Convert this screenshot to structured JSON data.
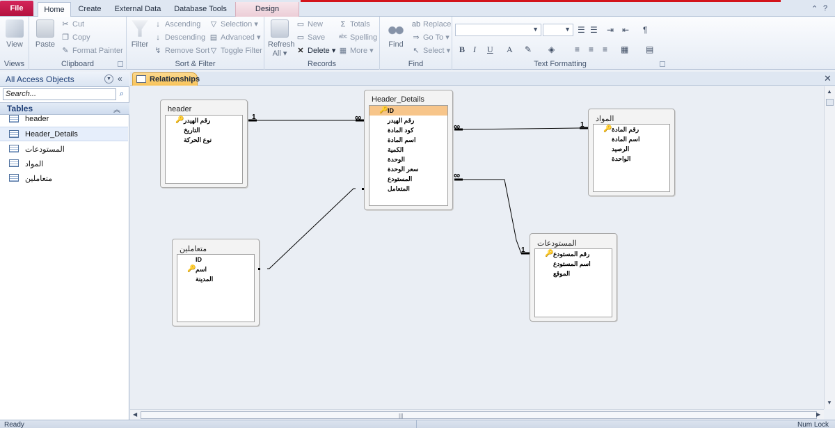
{
  "ribbon_tabs": {
    "file": "File",
    "home": "Home",
    "create": "Create",
    "external_data": "External Data",
    "database_tools": "Database Tools",
    "design": "Design"
  },
  "groups": {
    "views": {
      "label": "Views",
      "view": "View"
    },
    "clipboard": {
      "label": "Clipboard",
      "paste": "Paste",
      "cut": "Cut",
      "copy": "Copy",
      "format_painter": "Format Painter"
    },
    "sort_filter": {
      "label": "Sort & Filter",
      "filter": "Filter",
      "ascending": "Ascending",
      "descending": "Descending",
      "remove_sort": "Remove Sort",
      "selection": "Selection",
      "advanced": "Advanced",
      "toggle_filter": "Toggle Filter"
    },
    "records": {
      "label": "Records",
      "refresh": "Refresh",
      "refresh_all": "All",
      "new": "New",
      "save": "Save",
      "delete": "Delete",
      "totals": "Totals",
      "spelling": "Spelling",
      "more": "More"
    },
    "find": {
      "label": "Find",
      "find": "Find",
      "replace": "Replace",
      "go_to": "Go To",
      "select": "Select"
    },
    "text_formatting": {
      "label": "Text Formatting",
      "bold": "B",
      "italic": "I",
      "underline": "U",
      "font_color": "A"
    }
  },
  "nav": {
    "title": "All Access Objects",
    "search_placeholder": "Search...",
    "group": "Tables",
    "items": [
      {
        "label": "header"
      },
      {
        "label": "Header_Details"
      },
      {
        "label": "المستودعات"
      },
      {
        "label": "المواد"
      },
      {
        "label": "متعاملين"
      }
    ]
  },
  "document": {
    "tab": "Relationships"
  },
  "tables": {
    "header": {
      "title": "header",
      "fields": [
        "رقم الهيدر",
        "التاريخ",
        "نوع الحركة"
      ]
    },
    "header_details": {
      "title": "Header_Details",
      "fields": [
        "ID",
        "رقم الهيدر",
        "كود المادة",
        "اسم المادة",
        "الكمية",
        "الوحدة",
        "سعر الوحدة",
        "المستودع",
        "المتعامل"
      ]
    },
    "materials": {
      "title": "المواد",
      "fields": [
        "رقم المادة",
        "اسم المادة",
        "الرصيد",
        "الواحدة"
      ]
    },
    "dealers": {
      "title": "متعاملين",
      "fields": [
        "ID",
        "اسم",
        "المدينة"
      ]
    },
    "warehouses": {
      "title": "المستودعات",
      "fields": [
        "رقم المستودع",
        "اسم المستودع",
        "الموقع"
      ]
    }
  },
  "relationships": {
    "one": "1",
    "many": "∞"
  },
  "status": {
    "left": "Ready",
    "right": "Num Lock"
  },
  "colors": {
    "file_tab": "#c21b4e",
    "highlight_field": "#f7c58a",
    "doc_tab": "#f9c962",
    "title_redline": "#d3131a"
  }
}
